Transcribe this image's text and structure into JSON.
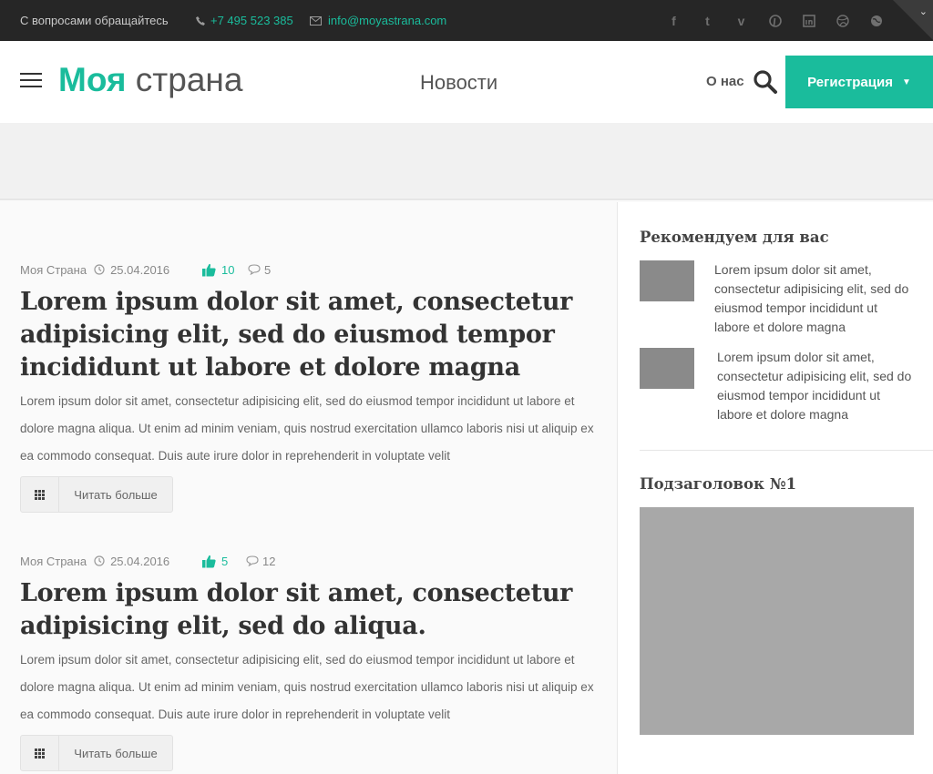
{
  "topbar": {
    "ask_text": "С вопросами обращайтесь",
    "phone": "+7 495 523 385",
    "email": "info@moyastrana.com",
    "socials": [
      "facebook-icon",
      "twitter-icon",
      "vimeo-icon",
      "pinterest-icon",
      "linkedin-icon",
      "dribbble-icon",
      "globe-icon"
    ]
  },
  "header": {
    "logo_bold": "Моя",
    "logo_light": " страна",
    "nav_news": "Новости",
    "nav_about": "О нас",
    "register_label": "Регистрация"
  },
  "posts": [
    {
      "author": "Моя Страна",
      "date": "25.04.2016",
      "likes": "10",
      "comments": "5",
      "title": "Lorem ipsum dolor sit amet, consectetur adipisicing elit, sed do eiusmod tempor incididunt ut labore et dolore magna",
      "excerpt": "Lorem ipsum dolor sit amet, consectetur adipisicing elit, sed do eiusmod tempor incididunt ut labore et dolore magna aliqua. Ut enim ad minim veniam, quis nostrud exercitation ullamco laboris nisi ut aliquip ex ea commodo consequat. Duis aute irure dolor in reprehenderit in voluptate velit",
      "read_more": "Читать больше"
    },
    {
      "author": "Моя Страна",
      "date": "25.04.2016",
      "likes": "5",
      "comments": "12",
      "title": "Lorem ipsum dolor sit amet, consectetur adipisicing elit, sed do aliqua.",
      "excerpt": "Lorem ipsum dolor sit amet, consectetur adipisicing elit, sed do eiusmod tempor incididunt ut labore et dolore magna aliqua. Ut enim ad minim veniam, quis nostrud exercitation ullamco laboris nisi ut aliquip ex ea commodo consequat. Duis aute irure dolor in reprehenderit in voluptate velit",
      "read_more": "Читать больше"
    }
  ],
  "sidebar": {
    "recommend_title": "Рекомендуем для вас",
    "recommend_items": [
      "Lorem ipsum dolor sit amet, consectetur adipisicing elit, sed do eiusmod tempor incididunt ut labore et dolore magna",
      "Lorem ipsum dolor sit amet, consectetur adipisicing elit, sed do eiusmod tempor incididunt ut labore et dolore magna"
    ],
    "subheading": "Подзаголовок №1"
  },
  "colors": {
    "accent": "#1abc9c",
    "topbar": "#262626"
  }
}
